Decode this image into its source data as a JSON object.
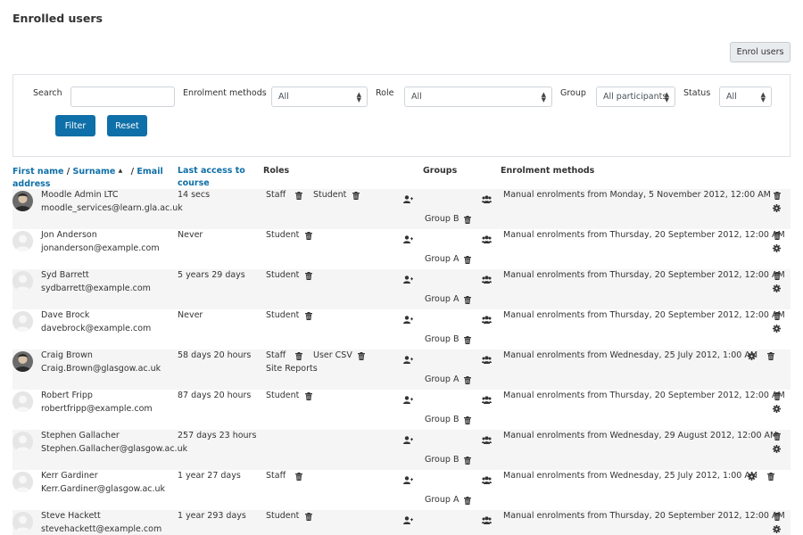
{
  "page": {
    "title": "Enrolled users",
    "enrol_button": "Enrol users"
  },
  "filter": {
    "search_label": "Search",
    "search_value": "",
    "enrol_methods_label": "Enrolment methods",
    "enrol_methods_value": "All",
    "role_label": "Role",
    "role_value": "All",
    "group_label": "Group",
    "group_value": "All participants",
    "status_label": "Status",
    "status_value": "All",
    "filter_button": "Filter",
    "reset_button": "Reset"
  },
  "table": {
    "headers": {
      "first_name": "First name",
      "sep1": " / ",
      "surname": "Surname",
      "sort_arrow": "▲",
      "sep2": " / ",
      "email": "Email",
      "address": "address",
      "last_access_1": "Last access to",
      "last_access_2": "course",
      "roles": "Roles",
      "groups": "Groups",
      "enrolment_methods": "Enrolment methods"
    },
    "rows": [
      {
        "name": "Moodle Admin LTC",
        "email": "moodle_services@learn.gla.ac.uk",
        "last_access": "14 secs",
        "roles": [
          "Staff",
          "Student"
        ],
        "roles_line2": "",
        "group": "Group B",
        "enrolment": "Manual enrolments from Monday, 5 November 2012, 12:00 AM",
        "avatar": "photo"
      },
      {
        "name": "Jon Anderson",
        "email": "jonanderson@example.com",
        "last_access": "Never",
        "roles": [
          "Student"
        ],
        "roles_line2": "",
        "group": "Group A",
        "enrolment": "Manual enrolments from Thursday, 20 September 2012, 12:00 AM",
        "avatar": "default"
      },
      {
        "name": "Syd Barrett",
        "email": "sydbarrett@example.com",
        "last_access": "5 years 29 days",
        "roles": [
          "Student"
        ],
        "roles_line2": "",
        "group": "Group A",
        "enrolment": "Manual enrolments from Thursday, 20 September 2012, 12:00 AM",
        "avatar": "default"
      },
      {
        "name": "Dave Brock",
        "email": "davebrock@example.com",
        "last_access": "Never",
        "roles": [
          "Student"
        ],
        "roles_line2": "",
        "group": "Group B",
        "enrolment": "Manual enrolments from Thursday, 20 September 2012, 12:00 AM",
        "avatar": "default"
      },
      {
        "name": "Craig Brown",
        "email": "Craig.Brown@glasgow.ac.uk",
        "last_access": "58 days 20 hours",
        "roles": [
          "Staff",
          "User CSV"
        ],
        "roles_line2": "Site Reports",
        "group": "Group A",
        "enrolment": "Manual enrolments from Wednesday, 25 July 2012, 1:00 AM",
        "avatar": "photo"
      },
      {
        "name": "Robert Fripp",
        "email": "robertfripp@example.com",
        "last_access": "87 days 20 hours",
        "roles": [
          "Student"
        ],
        "roles_line2": "",
        "group": "Group B",
        "enrolment": "Manual enrolments from Thursday, 20 September 2012, 12:00 AM",
        "avatar": "default"
      },
      {
        "name": "Stephen Gallacher",
        "email": "Stephen.Gallacher@glasgow.ac.uk",
        "last_access": "257 days 23 hours",
        "roles": [],
        "roles_line2": "",
        "group": "Group B",
        "enrolment": "Manual enrolments from Wednesday, 29 August 2012, 12:00 AM",
        "avatar": "default"
      },
      {
        "name": "Kerr Gardiner",
        "email": "Kerr.Gardiner@glasgow.ac.uk",
        "last_access": "1 year 27 days",
        "roles": [
          "Staff"
        ],
        "roles_line2": "",
        "group": "Group A",
        "enrolment": "Manual enrolments from Wednesday, 25 July 2012, 1:00 AM",
        "avatar": "default"
      },
      {
        "name": "Steve Hackett",
        "email": "stevehackett@example.com",
        "last_access": "1 year 293 days",
        "roles": [
          "Student"
        ],
        "roles_line2": "",
        "group": "",
        "enrolment": "Manual enrolments from Thursday, 20 September 2012, 12:00 AM",
        "avatar": "default"
      }
    ]
  },
  "icons": {
    "trash": "trash-icon",
    "gear": "gear-icon",
    "add_role": "add-role-icon",
    "groups": "groups-icon",
    "sort": "sort-ascending-icon"
  },
  "colors": {
    "link": "#0f6fa8",
    "primary_button": "#0f6fa8",
    "stripe": "#f5f5f5"
  }
}
